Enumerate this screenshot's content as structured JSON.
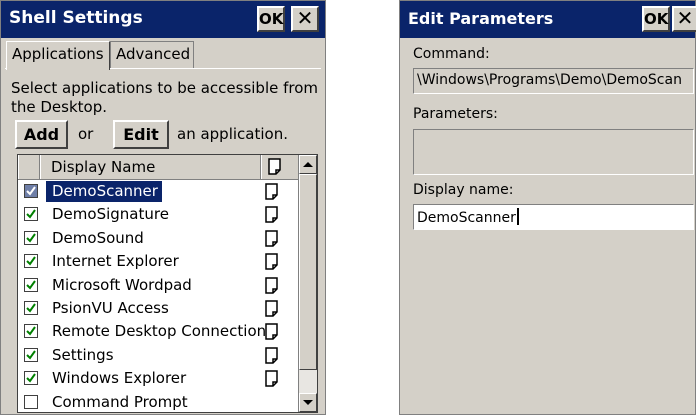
{
  "shell": {
    "title": "Shell Settings",
    "ok_label": "OK",
    "close_label": "✕",
    "tabs": [
      "Applications",
      "Advanced"
    ],
    "instructions_line1": "Select applications to be accessible from",
    "instructions_line2": "the Desktop.",
    "add_label": "Add",
    "or_label": "or",
    "edit_label": "Edit",
    "suffix_label": "an application.",
    "list": {
      "header": "Display Name",
      "items": [
        {
          "name": "DemoScanner",
          "checked": true,
          "selected": true,
          "doc_icon": "document-icon"
        },
        {
          "name": "DemoSignature",
          "checked": true,
          "selected": false,
          "doc_icon": "document-icon"
        },
        {
          "name": "DemoSound",
          "checked": true,
          "selected": false,
          "doc_icon": "document-icon"
        },
        {
          "name": "Internet Explorer",
          "checked": true,
          "selected": false,
          "doc_icon": "document-icon"
        },
        {
          "name": "Microsoft Wordpad",
          "checked": true,
          "selected": false,
          "doc_icon": "document-icon"
        },
        {
          "name": "PsionVU Access",
          "checked": true,
          "selected": false,
          "doc_icon": "document-icon"
        },
        {
          "name": "Remote Desktop Connection",
          "checked": true,
          "selected": false,
          "doc_icon": "document-icon"
        },
        {
          "name": "Settings",
          "checked": true,
          "selected": false,
          "doc_icon": "document-icon"
        },
        {
          "name": "Windows Explorer",
          "checked": true,
          "selected": false,
          "doc_icon": "document-icon"
        },
        {
          "name": "Command Prompt",
          "checked": false,
          "selected": false,
          "doc_icon": ""
        }
      ]
    }
  },
  "edit": {
    "title": "Edit Parameters",
    "ok_label": "OK",
    "close_label": "✕",
    "command_label": "Command:",
    "command_value": "\\Windows\\Programs\\Demo\\DemoScan",
    "parameters_label": "Parameters:",
    "parameters_value": "",
    "display_name_label": "Display name:",
    "display_name_value": "DemoScanner"
  },
  "colors": {
    "titlebar": "#0a246a",
    "window_face": "#d4d0c8",
    "check": "#008000"
  }
}
